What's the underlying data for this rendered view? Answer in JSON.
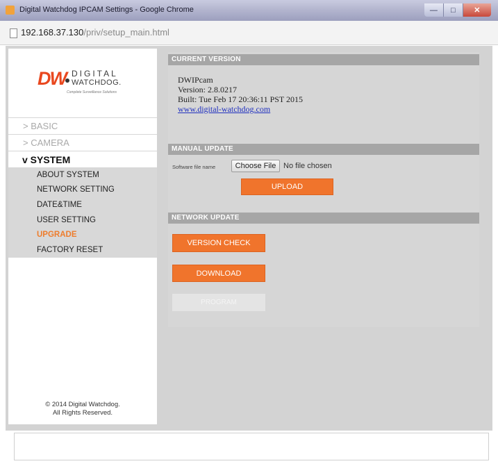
{
  "window": {
    "title": "Digital Watchdog IPCAM Settings - Google Chrome"
  },
  "address": {
    "host": "192.168.37.130",
    "path": "/priv/setup_main.html"
  },
  "logo": {
    "brand": "DW",
    "line1": "DIGITAL",
    "line2": "WATCHDOG.",
    "tagline": "Complete Surveillance Solutions"
  },
  "sidebar": {
    "basic": "> BASIC",
    "camera": "> CAMERA",
    "system": "v SYSTEM",
    "items": [
      {
        "label": "ABOUT SYSTEM"
      },
      {
        "label": "NETWORK SETTING"
      },
      {
        "label": "DATE&TIME"
      },
      {
        "label": "USER SETTING"
      },
      {
        "label": "UPGRADE"
      },
      {
        "label": "FACTORY RESET"
      }
    ],
    "copyright_line1": "© 2014 Digital Watchdog.",
    "copyright_line2": "All Rights Reserved."
  },
  "current_version": {
    "header": "CURRENT VERSION",
    "model": "DWIPcam",
    "version": "Version: 2.8.0217",
    "built": "Built: Tue Feb 17 20:36:11 PST 2015",
    "link": "www.digital-watchdog.com"
  },
  "manual_update": {
    "header": "MANUAL UPDATE",
    "file_label": "Software file name",
    "choose_button": "Choose File",
    "no_file": "No file chosen",
    "upload_button": "UPLOAD"
  },
  "network_update": {
    "header": "NETWORK UPDATE",
    "version_check_button": "VERSION CHECK",
    "download_button": "DOWNLOAD",
    "program_button": "PROGRAM"
  },
  "colors": {
    "accent": "#f0742c",
    "active_menu": "#ee7d2d",
    "section_header": "#a6a6a6"
  }
}
